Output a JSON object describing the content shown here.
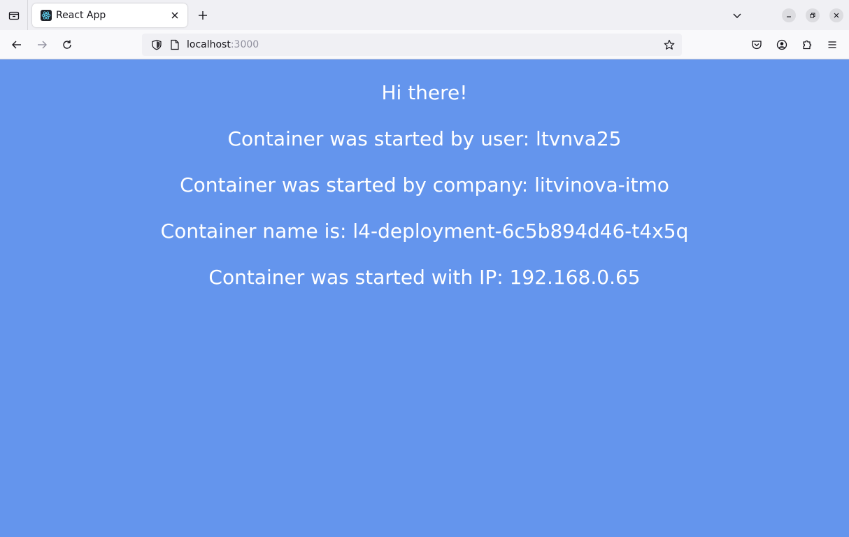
{
  "tab": {
    "title": "React App"
  },
  "urlbar": {
    "host": "localhost",
    "port": ":3000"
  },
  "content": {
    "greeting": "Hi there!",
    "user_line": "Container was started by user: ltvnva25",
    "company_line": "Container was started by company: litvinova-itmo",
    "name_line": "Container name is: l4-deployment-6c5b894d46-t4x5q",
    "ip_line": "Container was started with IP: 192.168.0.65"
  },
  "colors": {
    "page_background": "#6495ed",
    "text": "#ffffff"
  },
  "icons": {
    "tab_list": "tab-list-icon",
    "favicon": "react-logo-icon",
    "tab_close": "close-icon",
    "new_tab": "plus-icon",
    "tab_overflow": "chevron-down-icon",
    "minimize": "minimize-icon",
    "restore": "restore-icon",
    "close_window": "close-icon",
    "back": "back-arrow-icon",
    "forward": "forward-arrow-icon",
    "reload": "reload-icon",
    "shield": "shield-icon",
    "page": "page-icon",
    "bookmark": "star-icon",
    "pocket": "pocket-icon",
    "account": "account-icon",
    "extensions": "puzzle-icon",
    "menu": "hamburger-menu-icon"
  }
}
